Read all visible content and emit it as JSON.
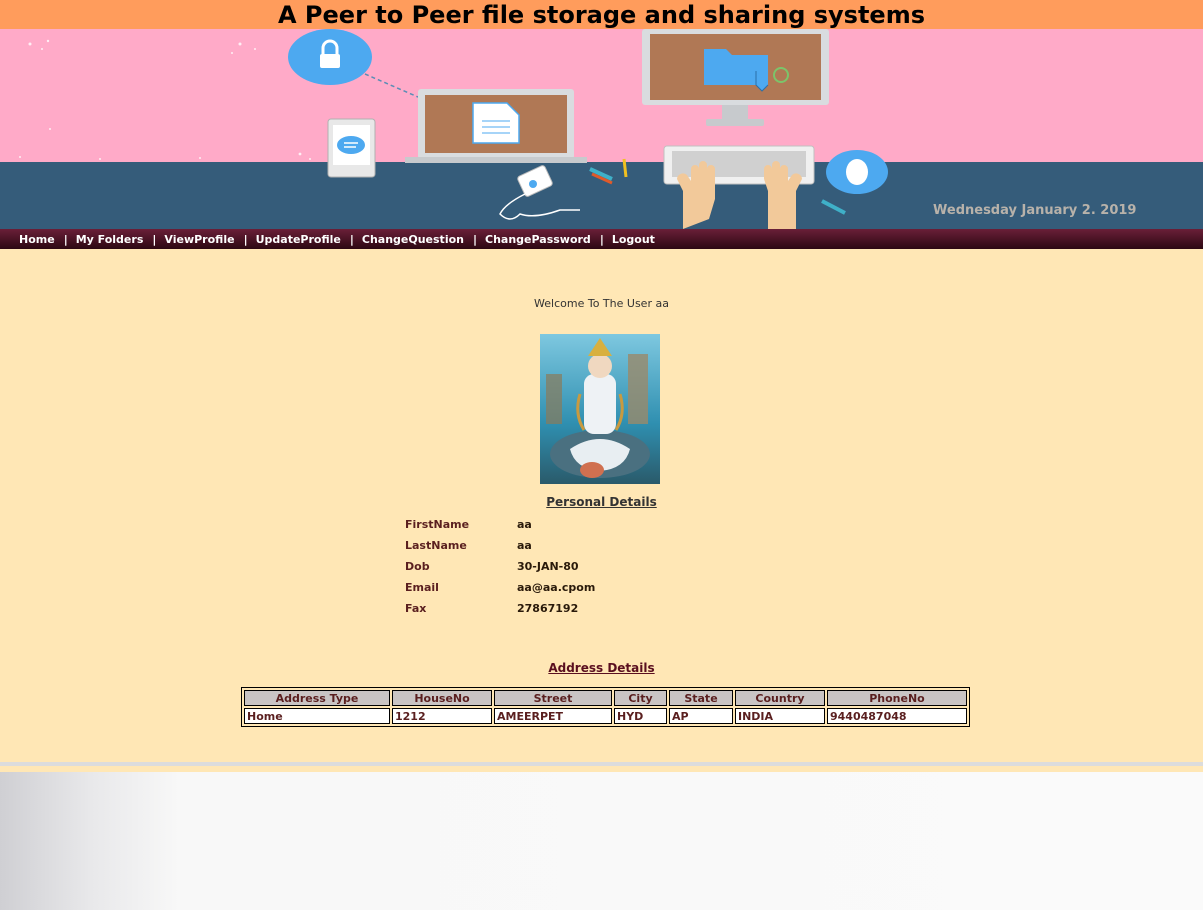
{
  "header": {
    "title": "A Peer to Peer file storage and sharing systems",
    "date": "Wednesday January 2. 2019"
  },
  "nav": {
    "items": [
      {
        "label": "Home"
      },
      {
        "label": "My Folders"
      },
      {
        "label": "ViewProfile"
      },
      {
        "label": "UpdateProfile"
      },
      {
        "label": "ChangeQuestion"
      },
      {
        "label": "ChangePassword"
      },
      {
        "label": "Logout"
      }
    ],
    "separator": "|"
  },
  "main": {
    "welcome": "Welcome To The User aa",
    "personal_title": "Personal Details",
    "personal": [
      {
        "label": "FirstName",
        "value": "aa"
      },
      {
        "label": "LastName",
        "value": "aa"
      },
      {
        "label": "Dob",
        "value": "30-JAN-80"
      },
      {
        "label": "Email",
        "value": "aa@aa.cpom"
      },
      {
        "label": "Fax",
        "value": "27867192"
      }
    ],
    "address_title": "Address Details",
    "address_table": {
      "headers": [
        "Address Type",
        "HouseNo",
        "Street",
        "City",
        "State",
        "Country",
        "PhoneNo"
      ],
      "rows": [
        [
          "Home",
          "1212",
          "AMEERPET",
          "HYD",
          "AP",
          "INDIA",
          "9440487048"
        ]
      ]
    }
  },
  "colors": {
    "title_bar": "#ff9c5c",
    "banner_pink": "#ffaac8",
    "banner_floor": "#355c7a",
    "content_bg": "#ffe7b5",
    "nav_dark": "#4a1226"
  }
}
